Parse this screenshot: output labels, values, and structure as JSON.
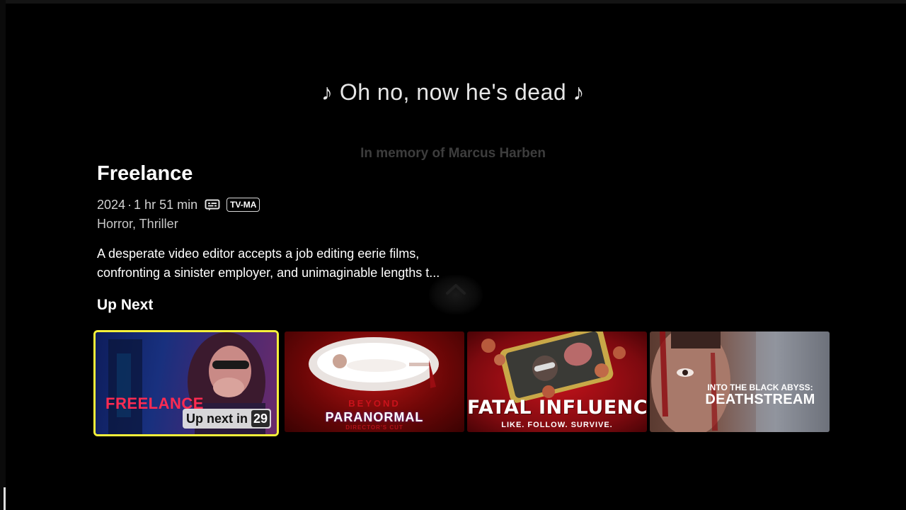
{
  "subtitle": {
    "text": "♪ Oh no, now he's dead ♪"
  },
  "memorial": {
    "text": "In memory of Marcus Harben"
  },
  "movie": {
    "title": "Freelance",
    "year": "2024",
    "separator": "·",
    "duration": "1 hr 51 min",
    "cc_icon": "closed-captions-icon",
    "rating": "TV-MA",
    "genres": "Horror, Thriller",
    "description_line1": "A desperate video editor accepts a job editing eerie films,",
    "description_line2": "confronting a sinister employer, and unimaginable lengths t..."
  },
  "up_next": {
    "label": "Up Next",
    "badge_label": "Up next in",
    "countdown": "29",
    "focus_color": "#f5f03a",
    "cards": [
      {
        "title": "FREELANCE"
      },
      {
        "title_top": "BEYOND",
        "title": "PARANORMAL",
        "subtitle": "DIRECTOR'S CUT"
      },
      {
        "title": "FATAL INFLUENCE",
        "tagline": "LIKE. FOLLOW. SURVIVE."
      },
      {
        "title_top": "INTO THE BLACK ABYSS:",
        "title": "DEATHSTREAM"
      }
    ]
  }
}
